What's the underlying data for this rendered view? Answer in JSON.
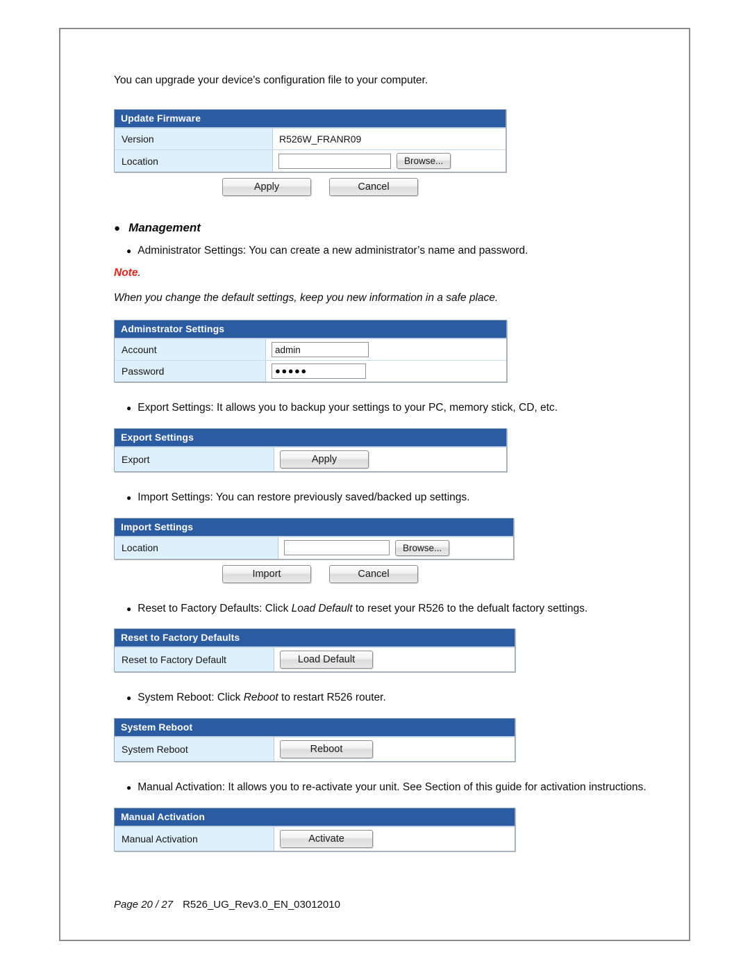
{
  "page": {
    "intro_paragraph": "You can upgrade your device's configuration file to your computer.",
    "footer_page": "Page 20 / 27",
    "footer_doc": "R526_UG_Rev3.0_EN_03012010",
    "bullet_glyph": "●",
    "subbullet_glyph": "●"
  },
  "colors": {
    "panel_header_bg": "#2b5ba0",
    "panel_label_bg": "#ddf0fb",
    "note_red": "#e8231a",
    "page_border": "#8a8a8a"
  },
  "update_firmware": {
    "header": "Update Firmware",
    "rows": [
      {
        "label": "Version",
        "value": "R526W_FRANR09"
      },
      {
        "label": "Location",
        "value": "",
        "browse_label": "Browse..."
      }
    ],
    "apply_label": "Apply",
    "cancel_label": "Cancel"
  },
  "management": {
    "heading": "Management",
    "admin_bullet": "Administrator Settings: You can create a new administrator’s name and password.",
    "note_label": "Note",
    "note_punct": ".",
    "note_text": "When you change the default settings, keep you new information in a safe place."
  },
  "administrator_settings": {
    "header": "Adminstrator Settings",
    "rows": [
      {
        "label": "Account",
        "value": "admin",
        "type": "text"
      },
      {
        "label": "Password",
        "value": "●●●●●",
        "type": "password"
      }
    ]
  },
  "export_settings": {
    "bullet": "Export Settings: It allows you to backup your settings to your PC, memory stick, CD, etc.",
    "header": "Export Settings",
    "row_label": "Export",
    "apply_label": "Apply"
  },
  "import_settings": {
    "bullet": "Import Settings: You can restore previously saved/backed up settings.",
    "header": "Import Settings",
    "row_label": "Location",
    "value": "",
    "browse_label": "Browse...",
    "import_label": "Import",
    "cancel_label": "Cancel"
  },
  "reset_factory": {
    "bullet_pre": "Reset to Factory Defaults: Click ",
    "bullet_em": "Load Default",
    "bullet_post": " to reset your R526 to the defualt factory settings.",
    "header": "Reset to Factory Defaults",
    "row_label": "Reset to Factory Default",
    "button_label": "Load Default"
  },
  "system_reboot": {
    "bullet_pre": "System Reboot: Click ",
    "bullet_em": "Reboot",
    "bullet_post": " to restart R526 router.",
    "header": "System Reboot",
    "row_label": "System Reboot",
    "button_label": "Reboot"
  },
  "manual_activation": {
    "bullet": "Manual Activation: It allows you to re-activate your unit. See Section of this guide for activation instructions.",
    "header": "Manual Activation",
    "row_label": "Manual Activation",
    "button_label": "Activate"
  }
}
